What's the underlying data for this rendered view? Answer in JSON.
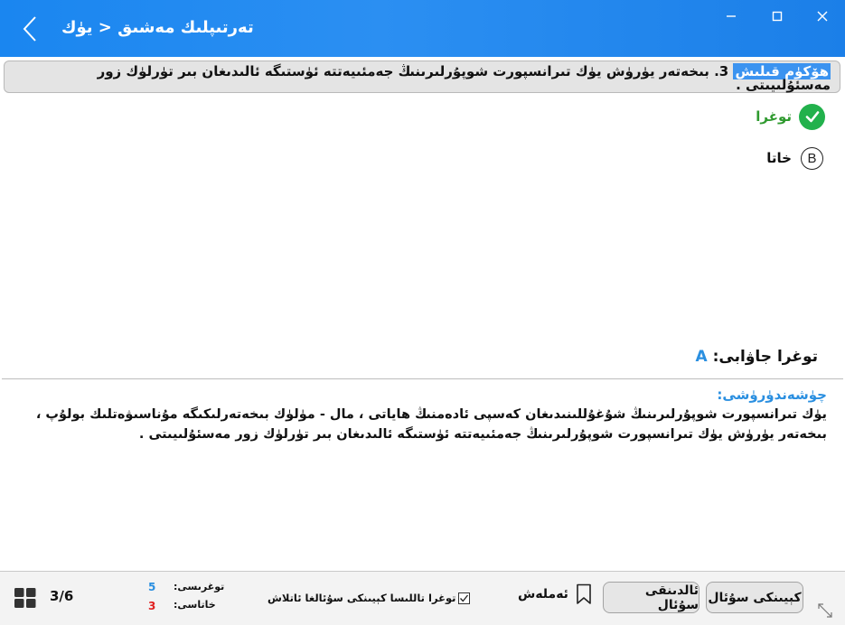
{
  "window": {
    "title": "تەرتىپلىك مەشىق < يۈك"
  },
  "question": {
    "tag": "ھۆكۈم قىلىش",
    "number": "3.",
    "text": "بىخەتەر يۈرۈش يۈك تىرانسپورت شوپۇرلىرىنىڭ جەمئىيەتتە ئۈستىگە ئالىدىغان بىر تۈرلۈك زور مەسئۇلىيىتى ."
  },
  "options": [
    {
      "label": "توغرا",
      "state": "selected-correct"
    },
    {
      "label": "خاتا",
      "marker": "B",
      "state": "unselected"
    }
  ],
  "answer": {
    "label": "توغرا جاۋابى:",
    "value": "A"
  },
  "explanation": {
    "heading": "چۈشەندۈرۈشى:",
    "text": "يۈك تىرانسپورت شوپۇرلىرىنىڭ شۇغۇللىنىدىغان كەسپى ئادەمنىڭ ھاياتى ، مال - مۈلۈك بىخەتەرلىكىگە مۇناسىۋەتلىك بولۇپ ، بىخەتەر يۈرۈش يۈك تىرانسپورت شوپۇرلىرىنىڭ جەمئىيەتتە ئۈستىگە ئالىدىغان بىر تۈرلۈك زور مەسئۇلىيىتى ."
  },
  "footer": {
    "progress": "3/6",
    "correct_label": "توغرىسى:",
    "correct_count": "5",
    "wrong_label": "خاتاسى:",
    "wrong_count": "3",
    "auto_next_label": "توغرا تاللىسا كېيىنكى سۇئالغا ئاتلاش",
    "bookmark_label": "ئەملەش",
    "prev_label": "ئالدىنقى سۇئال",
    "next_label": "كېيىنكى سۇئال"
  },
  "colors": {
    "titlebar": "#1a86f0",
    "accent_blue": "#2a8fe0",
    "correct_green": "#22b14c",
    "correct_count": "#2a8fe0",
    "wrong_count": "#e02020"
  }
}
